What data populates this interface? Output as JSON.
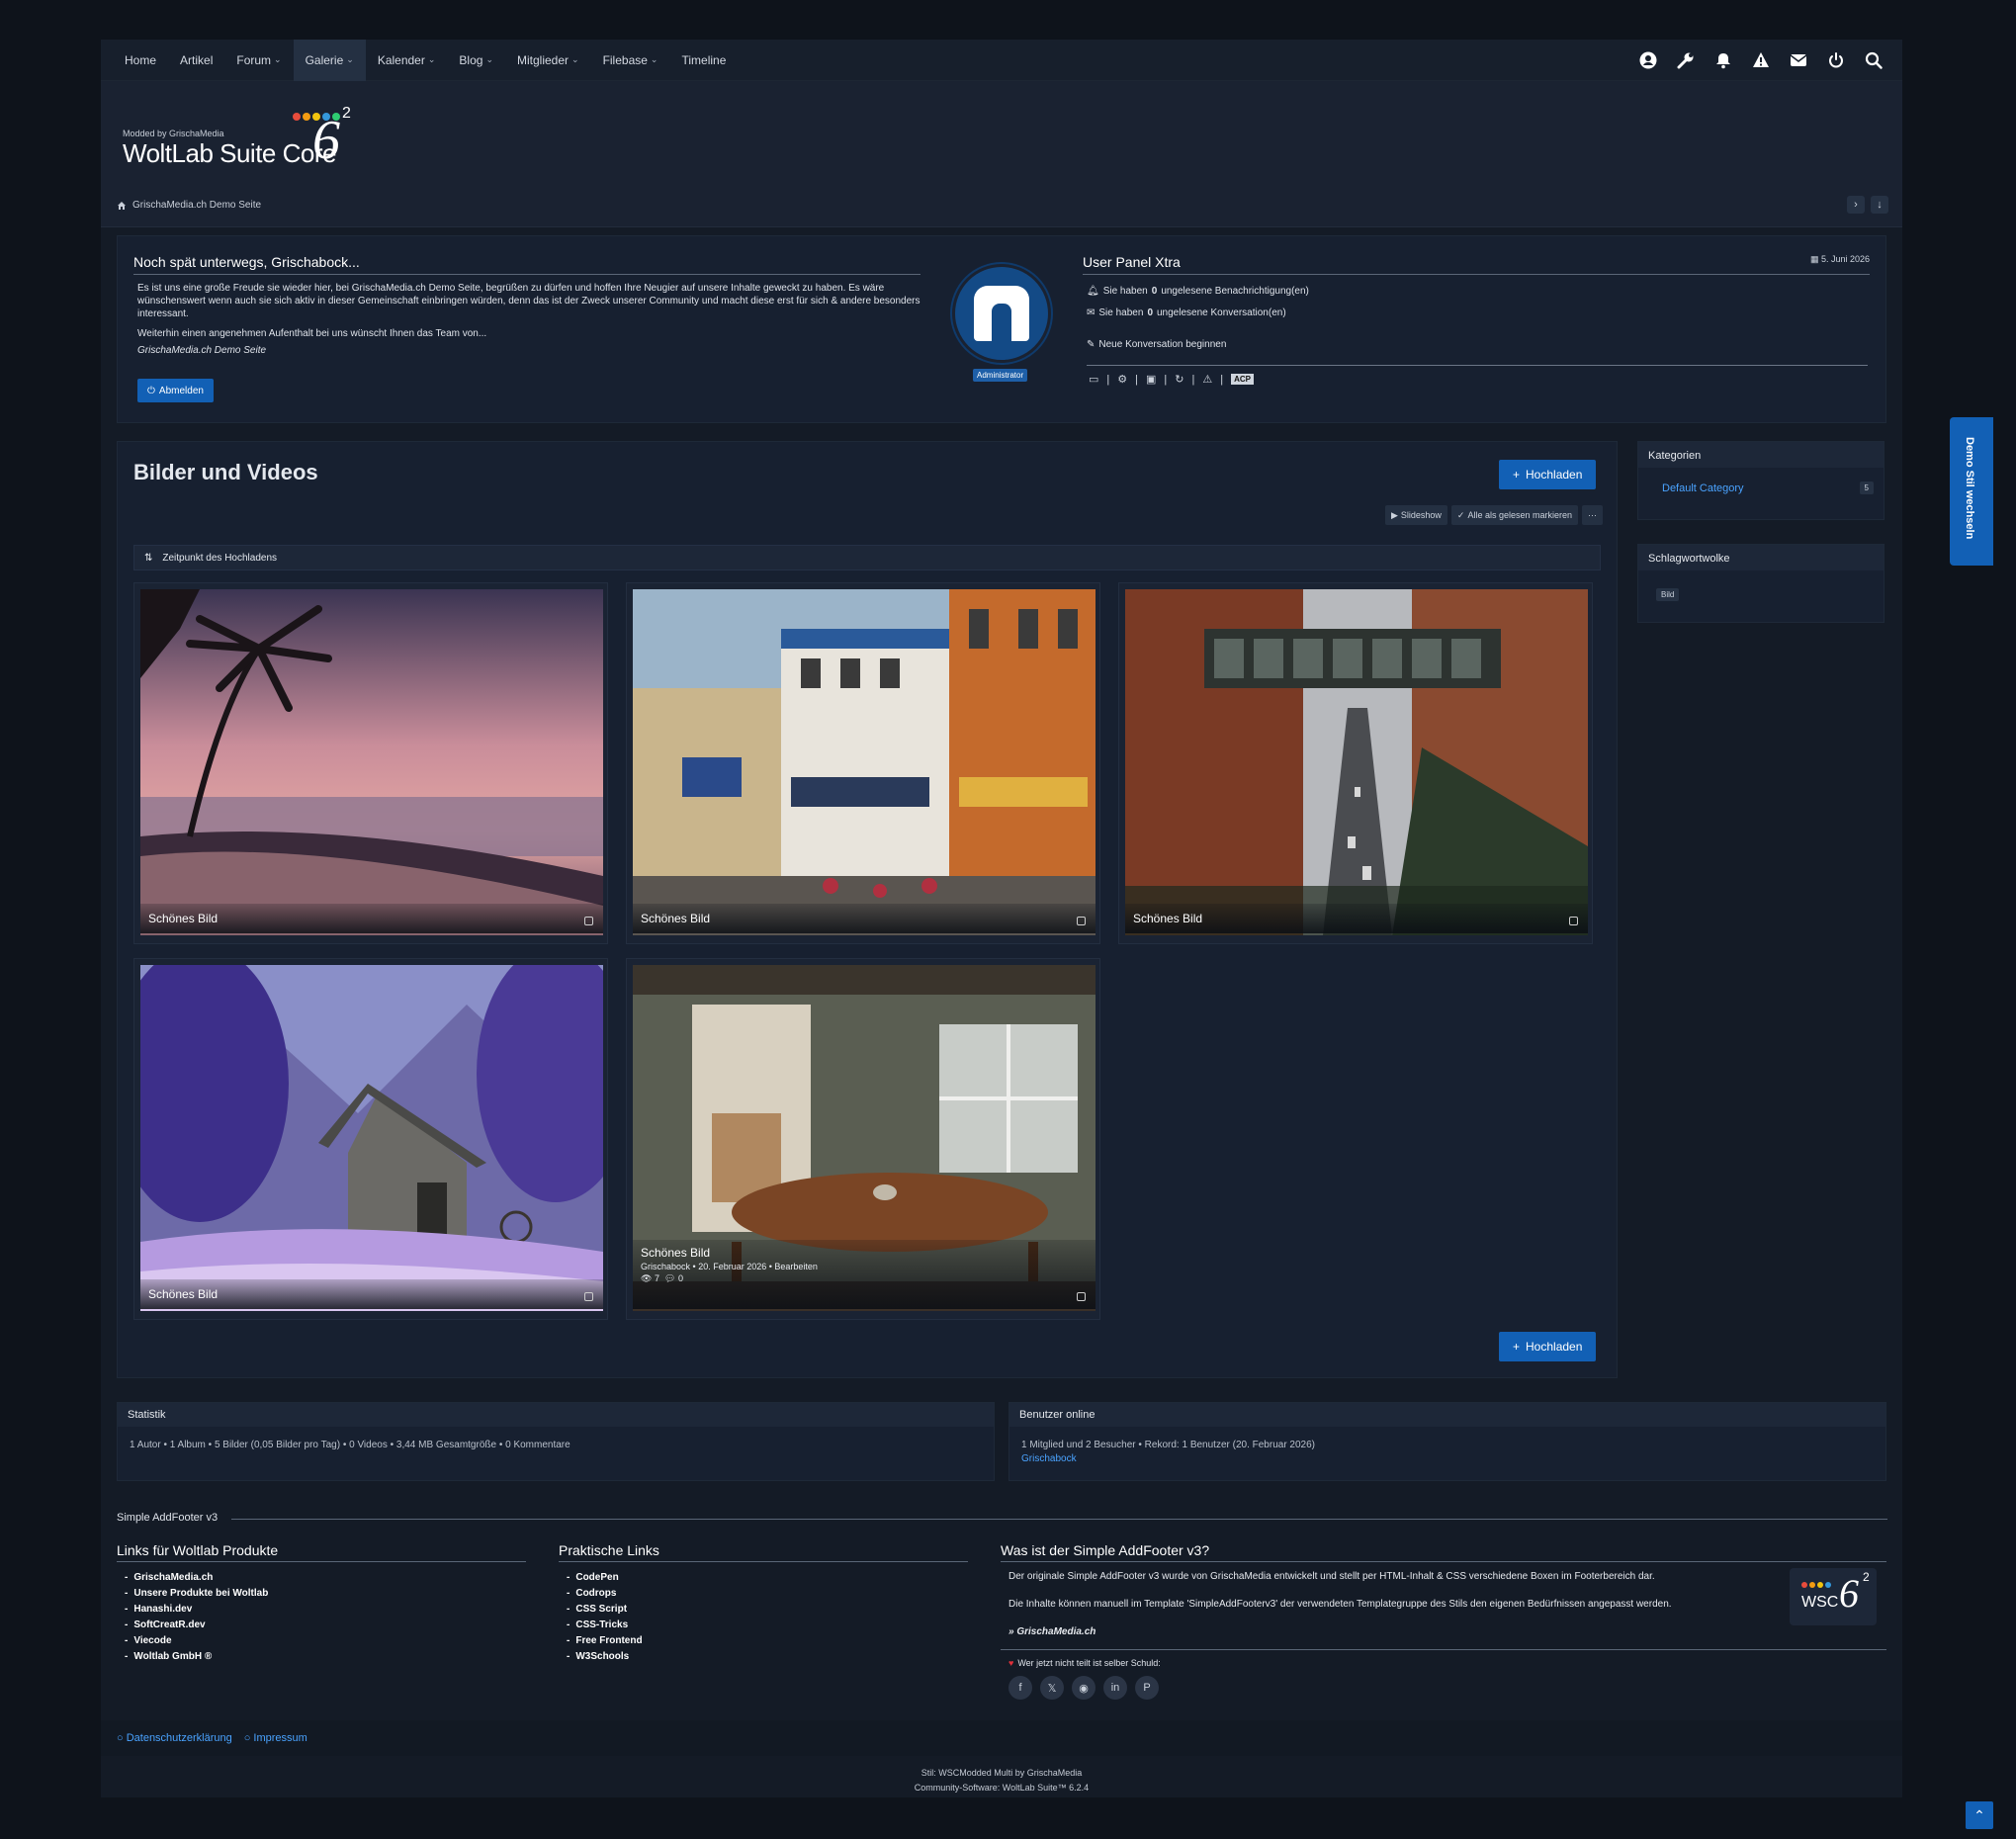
{
  "nav": {
    "items": [
      {
        "label": "Home",
        "caret": false,
        "active": false
      },
      {
        "label": "Artikel",
        "caret": false,
        "active": false
      },
      {
        "label": "Forum",
        "caret": true,
        "active": false
      },
      {
        "label": "Galerie",
        "caret": true,
        "active": true
      },
      {
        "label": "Kalender",
        "caret": true,
        "active": false
      },
      {
        "label": "Blog",
        "caret": true,
        "active": false
      },
      {
        "label": "Mitglieder",
        "caret": true,
        "active": false
      },
      {
        "label": "Filebase",
        "caret": true,
        "active": false
      },
      {
        "label": "Timeline",
        "caret": false,
        "active": false
      }
    ],
    "icons": [
      "user-icon",
      "wrench-icon",
      "bell-icon",
      "warning-icon",
      "envelope-icon",
      "power-icon",
      "search-icon"
    ]
  },
  "logo": {
    "small": "Modded by GrischaMedia",
    "main": "WoltLab Suite Core",
    "six": "6",
    "sup": "2"
  },
  "breadcrumb": {
    "label": "GrischaMedia.ch Demo Seite"
  },
  "welcome": {
    "title": "Noch spät unterwegs, Grischabock...",
    "text": "Es ist uns eine große Freude sie wieder hier, bei GrischaMedia.ch Demo Seite, begrüßen zu dürfen und hoffen Ihre Neugier auf unsere Inhalte geweckt zu haben. Es wäre wünschenswert wenn auch sie sich aktiv in dieser Gemeinschaft einbringen würden, denn das ist der Zweck unserer Community und macht diese erst für sich & andere besonders interessant.",
    "text2": "Weiterhin einen angenehmen Aufenthalt bei uns wünscht Ihnen das Team von...",
    "sign": "GrischaMedia.ch Demo Seite",
    "logout": "Abmelden",
    "role": "Administrator"
  },
  "userpanel": {
    "title": "User Panel Xtra",
    "date": "5. Juni 2026",
    "notif_pre": "Sie haben",
    "notif_count": "0",
    "notif_post": "ungelesene Benachrichtigung(en)",
    "conv_pre": "Sie haben",
    "conv_count": "0",
    "conv_post": "ungelesene Konversation(en)",
    "new_conv": "Neue Konversation beginnen",
    "acp": "ACP"
  },
  "gallery": {
    "title": "Bilder und Videos",
    "upload": "Hochladen",
    "slideshow": "Slideshow",
    "mark_read": "Alle als gelesen markieren",
    "more": "···",
    "sort": "Zeitpunkt des Hochladens",
    "images": [
      {
        "title": "Schönes Bild"
      },
      {
        "title": "Schönes Bild"
      },
      {
        "title": "Schönes Bild"
      },
      {
        "title": "Schönes Bild"
      },
      {
        "title": "Schönes Bild",
        "author": "Grischabock",
        "date": "20. Februar 2026",
        "edit": "Bearbeiten",
        "views": "7",
        "comments": "0"
      }
    ]
  },
  "sidebar": {
    "categories_title": "Kategorien",
    "category": "Default Category",
    "category_count": "5",
    "tags_title": "Schlagwortwolke",
    "tag": "Bild"
  },
  "stats": {
    "title": "Statistik",
    "text": "1 Autor • 1 Album • 5 Bilder (0,05 Bilder pro Tag) • 0 Videos • 3,44 MB Gesamtgröße • 0 Kommentare"
  },
  "online": {
    "title": "Benutzer online",
    "text": "1 Mitglied und 2 Besucher • Rekord: 1 Benutzer (20. Februar 2026)",
    "user": "Grischabock"
  },
  "addfooter": {
    "title": "Simple AddFooter v3",
    "col1_title": "Links für Woltlab Produkte",
    "col1": [
      "GrischaMedia.ch",
      "Unsere Produkte bei Woltlab",
      "Hanashi.dev",
      "SoftCreatR.dev",
      "Viecode",
      "Woltlab GmbH ®"
    ],
    "col2_title": "Praktische Links",
    "col2": [
      "CodePen",
      "Codrops",
      "CSS Script",
      "CSS-Tricks",
      "Free Frontend",
      "W3Schools"
    ],
    "col3_title": "Was ist der Simple AddFooter v3?",
    "about1": "Der originale Simple AddFooter v3 wurde von GrischaMedia entwickelt und stellt per HTML-Inhalt & CSS verschiedene Boxen im Footerbereich dar.",
    "about2": "Die Inhalte können manuell im Template 'SimpleAddFooterv3' der verwendeten Templategruppe des Stils den eigenen Bedürfnissen angepasst werden.",
    "about_link": "» GrischaMedia.ch",
    "share": "Wer jetzt nicht teilt ist selber Schuld:",
    "social": [
      "facebook-icon",
      "x-icon",
      "reddit-icon",
      "linkedin-icon",
      "pinterest-icon"
    ],
    "wsc_logo": "WSC",
    "wsc_six": "6",
    "wsc_sup": "2"
  },
  "legal": {
    "privacy": "Datenschutzerklärung",
    "imprint": "Impressum"
  },
  "copyright": {
    "line1": "Stil: WSCModded Multi by GrischaMedia",
    "line2": "Community-Software: WoltLab Suite™ 6.2.4"
  },
  "style_switch": "Demo Stil wechseln",
  "colors": {
    "accent": "#1260b5",
    "link": "#4aa3ff",
    "bg": "#0e131b",
    "panel": "#172030"
  }
}
